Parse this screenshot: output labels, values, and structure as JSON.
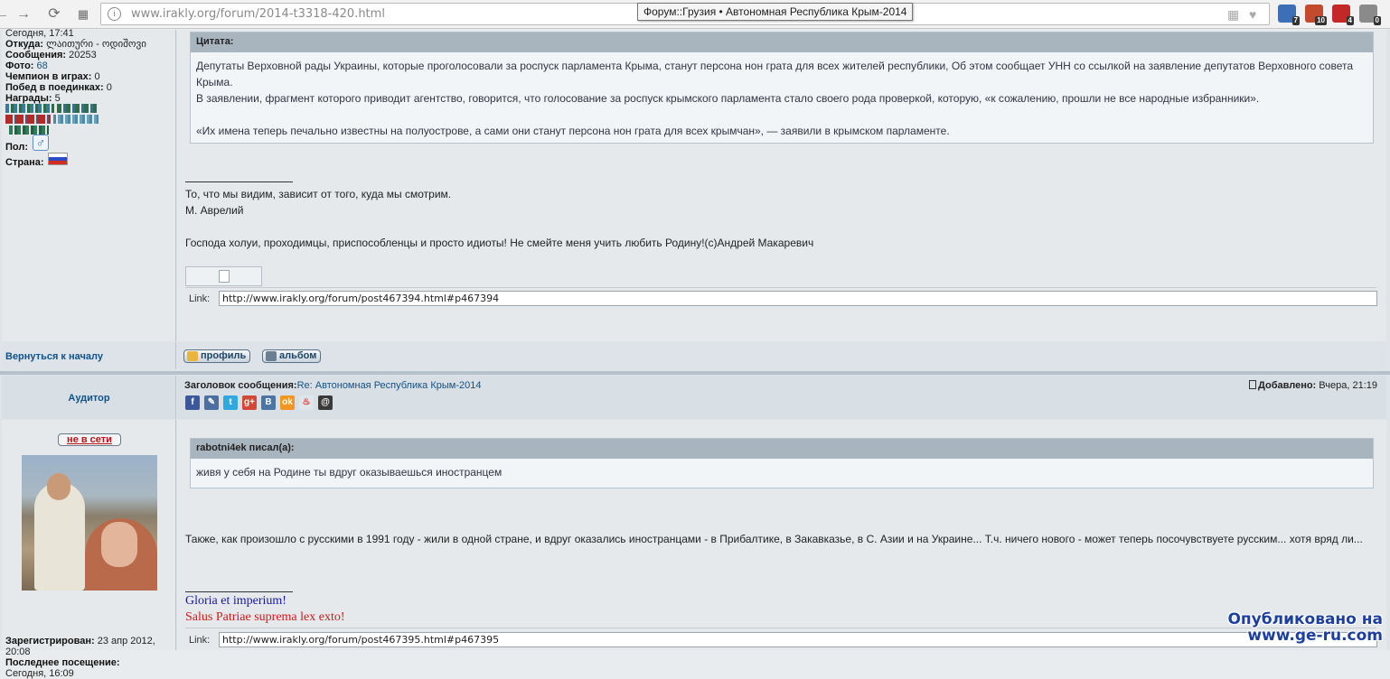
{
  "browser": {
    "url": "www.irakly.org/forum/2014-t3318-420.html",
    "tooltip": "Форум::Грузия • Автономная Республика Крым-2014",
    "extensions": [
      {
        "name": "ext-1",
        "count": "7",
        "color": "#3d6fb6"
      },
      {
        "name": "ext-2",
        "count": "10",
        "color": "#c24a2d"
      },
      {
        "name": "ext-3",
        "count": "4",
        "color": "#c42727"
      },
      {
        "name": "ext-4",
        "count": "0",
        "color": "#8a8a8a"
      }
    ]
  },
  "post1": {
    "profile": {
      "last_visit_value": "Сегодня, 17:41",
      "from_label": "Откуда:",
      "from_value": "ლაითური - ოდიშოვი",
      "messages_label": "Сообщения:",
      "messages_value": "20253",
      "photo_label": "Фото:",
      "photo_value": "68",
      "champion_label": "Чемпион в играх:",
      "champion_value": "0",
      "duels_label": "Побед в поединках:",
      "duels_value": "0",
      "awards_label": "Награды:",
      "awards_value": "5",
      "gender_label": "Пол:",
      "country_label": "Страна:"
    },
    "quote_head": "Цитата:",
    "quote_p1": "Депутаты Верховной рады Украины, которые проголосовали за роспуск парламента Крыма, станут персона нон грата для всех жителей республики, Об этом сообщает УНН со ссылкой на заявление депутатов Верховного совета Крыма.",
    "quote_p2": "В заявлении, фрагмент которого приводит агентство, говорится, что голосование за роспуск крымского парламента стало своего рода проверкой, которую, «к сожалению, прошли не все народные избранники».",
    "quote_p3": "«Их имена теперь печально известны на полуострове, а сами они станут персона нон грата для всех крымчан», — заявили в крымском парламенте.",
    "sig_line1": "То, что мы видим, зависит от того, куда мы смотрим.",
    "sig_line2": "М. Аврелий",
    "sig_line3": "Господа холуи, проходимцы, приспособленцы и просто идиоты! Не смейте меня учить любить Родину!(с)Андрей Макаревич",
    "link_label": "Link:",
    "link_value": "http://www.irakly.org/forum/post467394.html#p467394",
    "back_to_top": "Вернуться к началу",
    "btn_profile": "профиль",
    "btn_album": "альбом"
  },
  "post2": {
    "rank": "Аудитор",
    "online_status": "не в сети",
    "registered_label": "Зарегистрирован:",
    "registered_value": "23 апр 2012, 20:08",
    "last_visit_label": "Последнее посещение:",
    "last_visit_value": "Сегодня, 16:09",
    "subject_label": "Заголовок сообщения:",
    "subject_value": "Re: Автономная Республика Крым-2014",
    "added_label": "Добавлено:",
    "added_value": "Вчера, 21:19",
    "quote_head": "rabotni4ek писал(а):",
    "quote_body": "живя у себя на Родине ты вдруг оказываешься иностранцем",
    "body": "Также, как произошло с русскими в 1991 году - жили в одной стране, и вдруг оказались иностранцами - в Прибалтике, в Закавказье, в С. Азии и на Украине... Т.ч. ничего нового - может теперь посочувствуете русским... хотя вряд ли...",
    "sig_line1": "Gloria et imperium!",
    "sig_line2": "Salus Patriae suprema lex exto!",
    "link_label": "Link:",
    "link_value": "http://www.irakly.org/forum/post467395.html#p467395"
  },
  "social_icons": [
    {
      "name": "facebook-icon",
      "glyph": "f",
      "color": "#3b5998"
    },
    {
      "name": "livejournal-icon",
      "glyph": "✎",
      "color": "#4a6fa0"
    },
    {
      "name": "twitter-icon",
      "glyph": "t",
      "color": "#2fa9e0"
    },
    {
      "name": "googleplus-icon",
      "glyph": "g+",
      "color": "#d34836"
    },
    {
      "name": "vkontakte-icon",
      "glyph": "B",
      "color": "#4c75a3"
    },
    {
      "name": "odnoklassniki-icon",
      "glyph": "ok",
      "color": "#f29521"
    },
    {
      "name": "moimir-icon",
      "glyph": "♨",
      "color": "#e0e5ea"
    },
    {
      "name": "mail-agent-icon",
      "glyph": "@",
      "color": "#3a3a3a"
    }
  ],
  "watermark": {
    "line1": "Опубликовано на",
    "line2": "www.ge-ru.com"
  }
}
